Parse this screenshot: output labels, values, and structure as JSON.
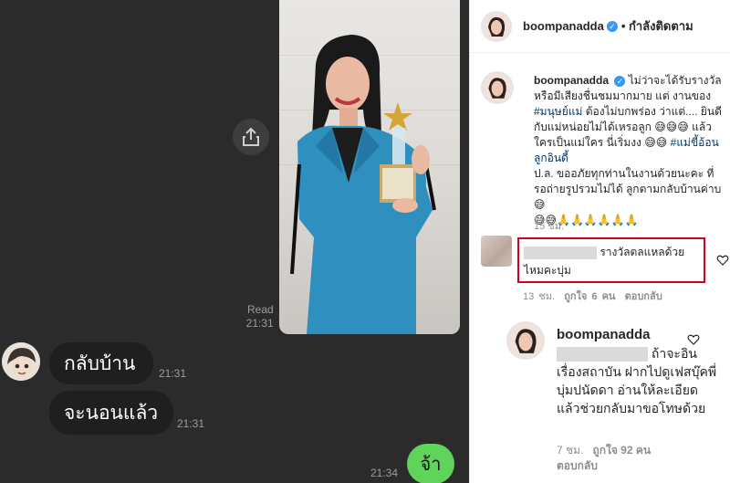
{
  "chat": {
    "read_label": "Read",
    "read_time": "21:31",
    "messages": [
      {
        "text": "กลับบ้าน",
        "time": "21:31"
      },
      {
        "text": "จะนอนแล้ว",
        "time": "21:31"
      }
    ],
    "my_message": {
      "text": "จ้า",
      "time": "21:34"
    },
    "photo_icon": "share-icon"
  },
  "instagram": {
    "header": {
      "username": "boompanadda",
      "follow_status": "• กำลังติดตาม"
    },
    "caption": {
      "username": "boompanadda",
      "line1": "ไม่ว่าจะได้รับรางวัลหรือมีเสียงชื่นชมมากมาย แต่ งานของ",
      "tag1": "#มนุษย์แม่",
      "line2": "ต้องไม่บกพร่อง ว่าแต่.... ยินดีกับแม่หน่อยไม่ได้เหรอลูก 😅😅😅 แล้วใครเป็นแม่ใคร นี่เริ่มงง 😅😅",
      "tag2": "#แม่ขี้อ้อนลูกอินดี้",
      "line3": "ป.ล. ขออภัยทุกท่านในงานด้วยนะคะ ที่รอถ่ายรูปรวมไม่ได้ ลูกตามกลับบ้านค่าบ 😅",
      "line4": "😅😅🙏🙏🙏🙏🙏🙏",
      "time": "15 ชม."
    },
    "comment": {
      "text": "รางวัลตลแหลด้วยไหมคะบุ่ม",
      "time": "13 ชม.",
      "likes": "ถูกใจ 6 คน",
      "reply_label": "ตอบกลับ"
    },
    "reply": {
      "username": "boompanadda",
      "text": "ถ้าจะอินเรื่องสถาบัน ฝากไปดูเฟสบุ๊คพี่ บุ่มปนัดดา อ่านให้ละเอียด แล้วช่วยกลับมาขอโทษด้วย",
      "time": "7 ชม.",
      "likes": "ถูกใจ 92 คน",
      "reply_label": "ตอบกลับ"
    },
    "colors": {
      "verified": "#3897f0",
      "hashtag": "#00376b",
      "highlight_box": "#d0021b"
    }
  }
}
